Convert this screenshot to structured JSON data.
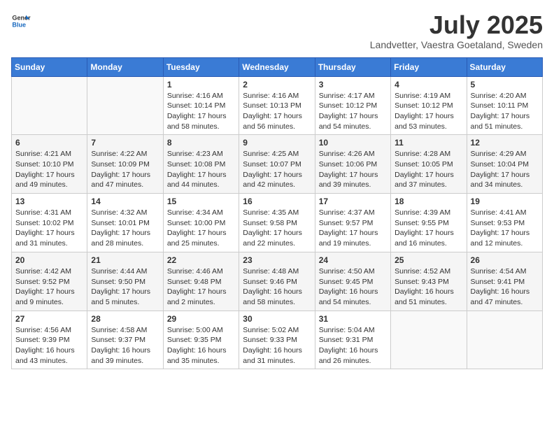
{
  "header": {
    "logo_general": "General",
    "logo_blue": "Blue",
    "title": "July 2025",
    "subtitle": "Landvetter, Vaestra Goetaland, Sweden"
  },
  "weekdays": [
    "Sunday",
    "Monday",
    "Tuesday",
    "Wednesday",
    "Thursday",
    "Friday",
    "Saturday"
  ],
  "weeks": [
    [
      {
        "day": "",
        "info": ""
      },
      {
        "day": "",
        "info": ""
      },
      {
        "day": "1",
        "info": "Sunrise: 4:16 AM\nSunset: 10:14 PM\nDaylight: 17 hours and 58 minutes."
      },
      {
        "day": "2",
        "info": "Sunrise: 4:16 AM\nSunset: 10:13 PM\nDaylight: 17 hours and 56 minutes."
      },
      {
        "day": "3",
        "info": "Sunrise: 4:17 AM\nSunset: 10:12 PM\nDaylight: 17 hours and 54 minutes."
      },
      {
        "day": "4",
        "info": "Sunrise: 4:19 AM\nSunset: 10:12 PM\nDaylight: 17 hours and 53 minutes."
      },
      {
        "day": "5",
        "info": "Sunrise: 4:20 AM\nSunset: 10:11 PM\nDaylight: 17 hours and 51 minutes."
      }
    ],
    [
      {
        "day": "6",
        "info": "Sunrise: 4:21 AM\nSunset: 10:10 PM\nDaylight: 17 hours and 49 minutes."
      },
      {
        "day": "7",
        "info": "Sunrise: 4:22 AM\nSunset: 10:09 PM\nDaylight: 17 hours and 47 minutes."
      },
      {
        "day": "8",
        "info": "Sunrise: 4:23 AM\nSunset: 10:08 PM\nDaylight: 17 hours and 44 minutes."
      },
      {
        "day": "9",
        "info": "Sunrise: 4:25 AM\nSunset: 10:07 PM\nDaylight: 17 hours and 42 minutes."
      },
      {
        "day": "10",
        "info": "Sunrise: 4:26 AM\nSunset: 10:06 PM\nDaylight: 17 hours and 39 minutes."
      },
      {
        "day": "11",
        "info": "Sunrise: 4:28 AM\nSunset: 10:05 PM\nDaylight: 17 hours and 37 minutes."
      },
      {
        "day": "12",
        "info": "Sunrise: 4:29 AM\nSunset: 10:04 PM\nDaylight: 17 hours and 34 minutes."
      }
    ],
    [
      {
        "day": "13",
        "info": "Sunrise: 4:31 AM\nSunset: 10:02 PM\nDaylight: 17 hours and 31 minutes."
      },
      {
        "day": "14",
        "info": "Sunrise: 4:32 AM\nSunset: 10:01 PM\nDaylight: 17 hours and 28 minutes."
      },
      {
        "day": "15",
        "info": "Sunrise: 4:34 AM\nSunset: 10:00 PM\nDaylight: 17 hours and 25 minutes."
      },
      {
        "day": "16",
        "info": "Sunrise: 4:35 AM\nSunset: 9:58 PM\nDaylight: 17 hours and 22 minutes."
      },
      {
        "day": "17",
        "info": "Sunrise: 4:37 AM\nSunset: 9:57 PM\nDaylight: 17 hours and 19 minutes."
      },
      {
        "day": "18",
        "info": "Sunrise: 4:39 AM\nSunset: 9:55 PM\nDaylight: 17 hours and 16 minutes."
      },
      {
        "day": "19",
        "info": "Sunrise: 4:41 AM\nSunset: 9:53 PM\nDaylight: 17 hours and 12 minutes."
      }
    ],
    [
      {
        "day": "20",
        "info": "Sunrise: 4:42 AM\nSunset: 9:52 PM\nDaylight: 17 hours and 9 minutes."
      },
      {
        "day": "21",
        "info": "Sunrise: 4:44 AM\nSunset: 9:50 PM\nDaylight: 17 hours and 5 minutes."
      },
      {
        "day": "22",
        "info": "Sunrise: 4:46 AM\nSunset: 9:48 PM\nDaylight: 17 hours and 2 minutes."
      },
      {
        "day": "23",
        "info": "Sunrise: 4:48 AM\nSunset: 9:46 PM\nDaylight: 16 hours and 58 minutes."
      },
      {
        "day": "24",
        "info": "Sunrise: 4:50 AM\nSunset: 9:45 PM\nDaylight: 16 hours and 54 minutes."
      },
      {
        "day": "25",
        "info": "Sunrise: 4:52 AM\nSunset: 9:43 PM\nDaylight: 16 hours and 51 minutes."
      },
      {
        "day": "26",
        "info": "Sunrise: 4:54 AM\nSunset: 9:41 PM\nDaylight: 16 hours and 47 minutes."
      }
    ],
    [
      {
        "day": "27",
        "info": "Sunrise: 4:56 AM\nSunset: 9:39 PM\nDaylight: 16 hours and 43 minutes."
      },
      {
        "day": "28",
        "info": "Sunrise: 4:58 AM\nSunset: 9:37 PM\nDaylight: 16 hours and 39 minutes."
      },
      {
        "day": "29",
        "info": "Sunrise: 5:00 AM\nSunset: 9:35 PM\nDaylight: 16 hours and 35 minutes."
      },
      {
        "day": "30",
        "info": "Sunrise: 5:02 AM\nSunset: 9:33 PM\nDaylight: 16 hours and 31 minutes."
      },
      {
        "day": "31",
        "info": "Sunrise: 5:04 AM\nSunset: 9:31 PM\nDaylight: 16 hours and 26 minutes."
      },
      {
        "day": "",
        "info": ""
      },
      {
        "day": "",
        "info": ""
      }
    ]
  ]
}
